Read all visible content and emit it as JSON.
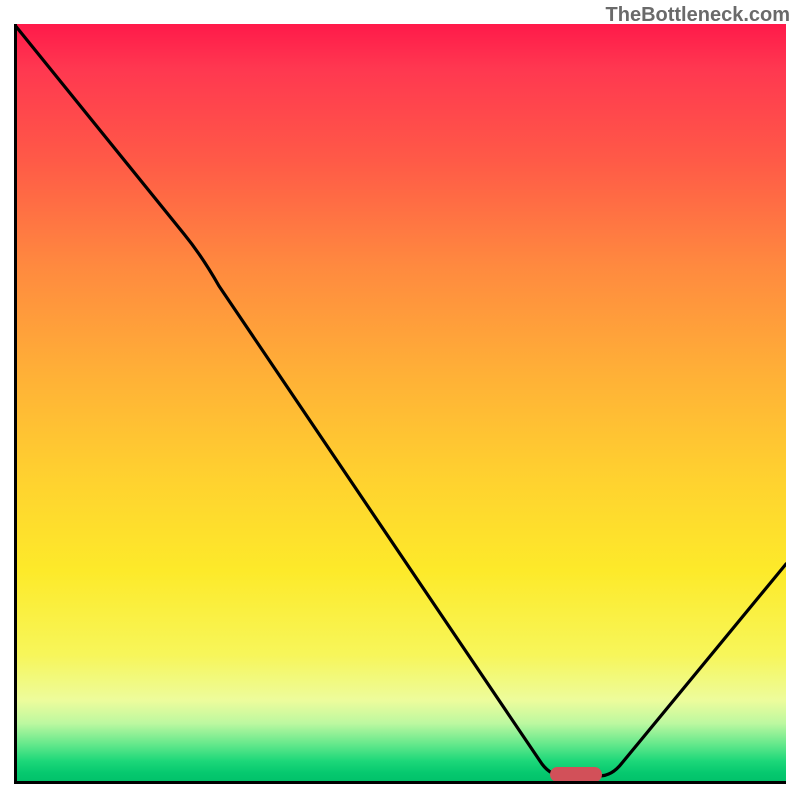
{
  "watermark": "TheBottleneck.com",
  "chart_data": {
    "type": "line",
    "title": "",
    "xlabel": "",
    "ylabel": "",
    "xlim": [
      0,
      100
    ],
    "ylim": [
      0,
      100
    ],
    "x": [
      0,
      22,
      69,
      74,
      78,
      100
    ],
    "values": [
      100,
      72,
      1,
      0,
      1,
      29
    ],
    "marker_x": 73,
    "marker_y": 0,
    "background_gradient": {
      "top": "#ff1a4a",
      "bottom": "#00bf69"
    }
  },
  "colors": {
    "curve": "#000000",
    "marker": "#d25059",
    "frame": "#000000",
    "watermark": "#6a6a6a"
  }
}
